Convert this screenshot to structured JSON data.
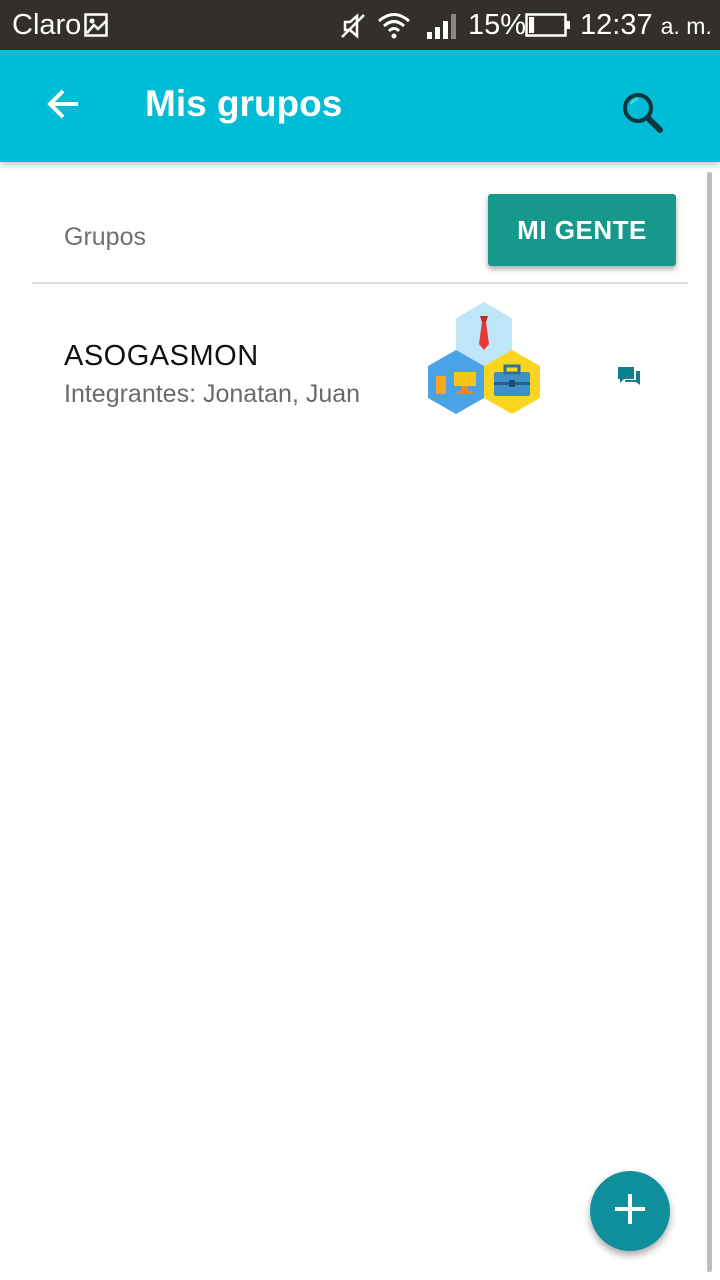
{
  "status_bar": {
    "carrier": "Claro",
    "battery_percent": "15%",
    "time": "12:37",
    "ampm": "a. m.",
    "battery_level": 0.15,
    "icons": [
      "gallery-icon",
      "mute-icon",
      "wifi-icon",
      "signal-icon",
      "battery-icon"
    ]
  },
  "app_bar": {
    "title": "Mis grupos",
    "back_icon": "arrow-back-icon",
    "search_icon": "search-icon"
  },
  "section": {
    "label": "Grupos",
    "action_label": "MI GENTE"
  },
  "groups": [
    {
      "name": "ASOGASMON",
      "members": "Integrantes: Jonatan, Juan",
      "image_icon": "business-hexagons-icon",
      "action_icon": "chat-icon"
    }
  ],
  "fab": {
    "icon": "plus-icon"
  },
  "colors": {
    "status_bar": "#33302c",
    "primary": "#00bcd4",
    "accent_button": "#16998a",
    "fab": "#0f8f9c",
    "chat_icon": "#0f7f8c"
  }
}
